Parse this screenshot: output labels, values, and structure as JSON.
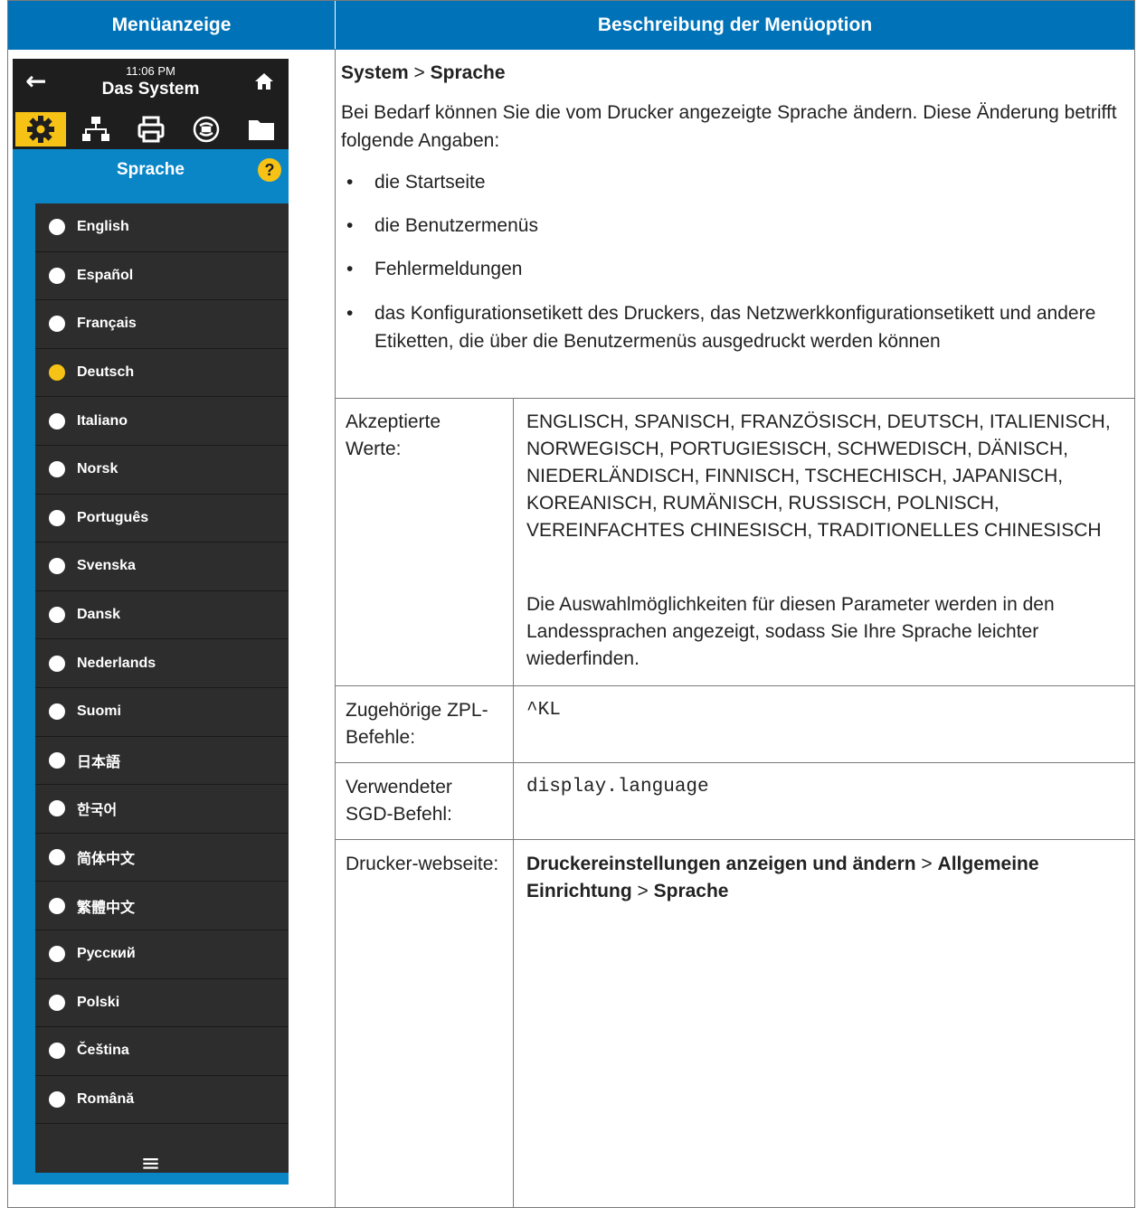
{
  "header": {
    "left": "Menüanzeige",
    "right": "Beschreibung der Menüoption"
  },
  "device": {
    "time": "11:06 PM",
    "title": "Das System",
    "panel_title": "Sprache",
    "help": "?",
    "languages": [
      {
        "label": "English",
        "selected": false
      },
      {
        "label": "Español",
        "selected": false
      },
      {
        "label": "Français",
        "selected": false
      },
      {
        "label": "Deutsch",
        "selected": true
      },
      {
        "label": "Italiano",
        "selected": false
      },
      {
        "label": "Norsk",
        "selected": false
      },
      {
        "label": "Português",
        "selected": false
      },
      {
        "label": "Svenska",
        "selected": false
      },
      {
        "label": "Dansk",
        "selected": false
      },
      {
        "label": "Nederlands",
        "selected": false
      },
      {
        "label": "Suomi",
        "selected": false
      },
      {
        "label": "日本語",
        "selected": false
      },
      {
        "label": "한국어",
        "selected": false
      },
      {
        "label": "简体中文",
        "selected": false
      },
      {
        "label": "繁體中文",
        "selected": false
      },
      {
        "label": "Русский",
        "selected": false
      },
      {
        "label": "Polski",
        "selected": false
      },
      {
        "label": "Čeština",
        "selected": false
      },
      {
        "label": "Română",
        "selected": false
      }
    ],
    "accent": "#f6c216",
    "panel_color": "#0a86c7"
  },
  "description": {
    "path_a": "System",
    "sep": " > ",
    "path_b": "Sprache",
    "intro": "Bei Bedarf können Sie die vom Drucker angezeigte Sprache ändern. Diese Änderung betrifft folgende Angaben:",
    "bullets": [
      "die Startseite",
      "die Benutzermenüs",
      "Fehlermeldungen",
      "das Konfigurationsetikett des Druckers, das Netzwerkkonfigurationsetikett und andere Etiketten, die über die Benutzermenüs ausgedruckt werden können"
    ]
  },
  "rows": {
    "accepted_label": "Akzeptierte Werte:",
    "accepted_value": "ENGLISCH, SPANISCH, FRANZÖSISCH, DEUTSCH, ITALIENISCH, NORWEGISCH, PORTUGIESISCH, SCHWEDISCH, DÄNISCH, NIEDERLÄNDISCH, FINNISCH, TSCHECHISCH, JAPANISCH, KOREANISCH, RUMÄNISCH, RUSSISCH, POLNISCH, VEREINFACHTES CHINESISCH, TRADITIONELLES CHINESISCH",
    "accepted_note": "Die Auswahlmöglichkeiten für diesen Parameter werden in den Landessprachen angezeigt, sodass Sie Ihre Sprache leichter wiederfinden.",
    "zpl_label": "Zugehörige ZPL-Befehle:",
    "zpl_value": "^KL",
    "sgd_label": "Verwendeter SGD-Befehl:",
    "sgd_value": "display.language",
    "web_label": "Drucker-webseite:",
    "web_a": "Druckereinstellungen anzeigen und ändern",
    "web_sep1": " > ",
    "web_b": "Allgemeine Einrichtung",
    "web_sep2": " > ",
    "web_c": "Sprache"
  }
}
